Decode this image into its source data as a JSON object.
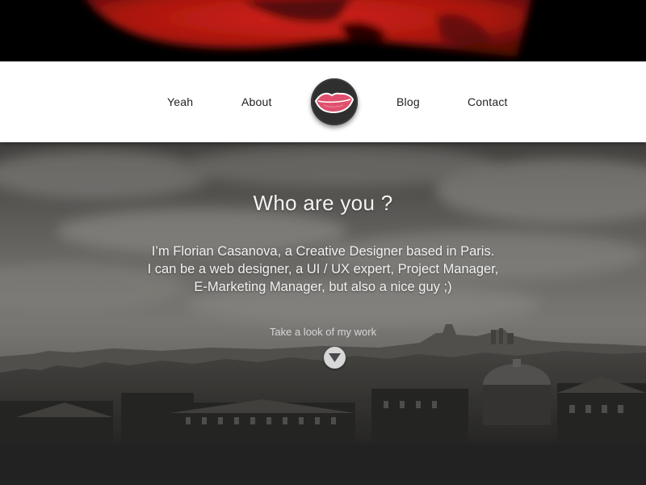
{
  "nav": {
    "items": [
      {
        "label": "Yeah"
      },
      {
        "label": "About"
      },
      {
        "label": "Blog"
      },
      {
        "label": "Contact"
      }
    ],
    "logo_icon": "lips-icon"
  },
  "hero": {
    "title": "Who are you ?",
    "lines": [
      "I’m Florian Casanova, a Creative Designer based in Paris.",
      "I can be a web designer, a UI / UX expert, Project Manager,",
      "E-Marketing Manager, but also a nice guy ;)"
    ],
    "cta": "Take a look of my work",
    "cta_icon": "arrow-down-icon"
  },
  "colors": {
    "banner_red": "#b81a12",
    "nav_bg": "#ffffff",
    "logo_bg": "#2f2f2f",
    "lips": "#e0506e",
    "footer_bg": "#222222"
  }
}
